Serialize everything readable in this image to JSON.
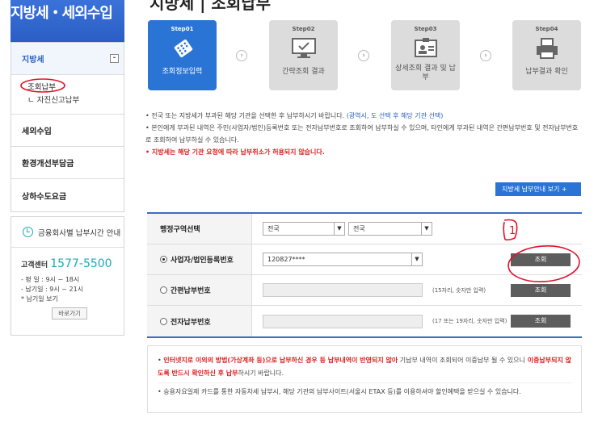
{
  "sidebar": {
    "title": "지방세・세외수입",
    "menu_main": "지방세",
    "toggle": "-",
    "sub_items": [
      "조회납부",
      "ㄴ 자진신고납부"
    ],
    "menu_items": [
      "세외수입",
      "환경개선부담금",
      "상하수도요금"
    ]
  },
  "info": {
    "head": "금융회사별 납부시간 안내",
    "call_label": "고객센터",
    "call_number": "1577-5500",
    "hours": [
      "- 평  일 : 9시 ~ 18시",
      "- 납기일 : 9시 ~ 21시",
      "  * 납기일 보기"
    ],
    "shortcut": "바로가기"
  },
  "page": {
    "title": "지방세 | 조회납부"
  },
  "steps": [
    {
      "num": "Step01",
      "label": "조회정보입력",
      "active": true
    },
    {
      "num": "Step02",
      "label": "간략조회 결과",
      "active": false
    },
    {
      "num": "Step03",
      "label": "상세조회 결과 및 납부",
      "active": false
    },
    {
      "num": "Step04",
      "label": "납부결과 확인",
      "active": false
    }
  ],
  "notes": {
    "n1": "• 전국 또는 지방세가 부과된 해당 기관을 선택한 후 납부하시기 바랍니다.",
    "n1b": "(광역시, 도 선택 후 해당 기관 선택)",
    "n2": "• 본인에게 부과된 내역은 주민(사업자/법인)등록번호 또는 전자납부번호로 조회하여 납부하실 수 있으며, 타인에게 부과된 내역은 간편납부번호 및 전자납부번호로 조회하여 납부하실 수 있습니다.",
    "n3": "• 지방세는 해당 기관 요청에 따라 납부취소가 허용되지 않습니다.",
    "guide_btn": "지방세 납부안내 보기 +"
  },
  "form": {
    "region_label": "행정구역선택",
    "region1": "전국",
    "region2": "전국",
    "biz_label": "사업자/법인등록번호",
    "biz_value": "120827****",
    "simple_label": "간편납부번호",
    "simple_hint": "(15자리, 숫자만 입력)",
    "etax_label": "전자납부번호",
    "etax_hint": "(17 또는 19자리, 숫자만 입력)",
    "query": "조회"
  },
  "bottom": {
    "b1_red": "인터넷지로 이외의 방법(가상계좌 등)으로 납부하신 경우 등 납부내역이 반영되지 않아",
    "b1_rest": " 기납부 내역이 조회되어 이중납부 될 수 있으니",
    "b1_red2": " 이중납부되지 않도록 반드시 확인하신 후 납부",
    "b1_end": "하시기 바랍니다.",
    "b2": "• 승용자요일제 카드를 통한 자동차세 납부시, 해당 기관의 납부사이트(서울시 ETAX 등)를 이용하셔야 할인혜택을 받으실 수 있습니다."
  },
  "annotation": {
    "mark": "1"
  },
  "colors": {
    "accent": "#2a74d6",
    "annotation": "#e0112b"
  }
}
